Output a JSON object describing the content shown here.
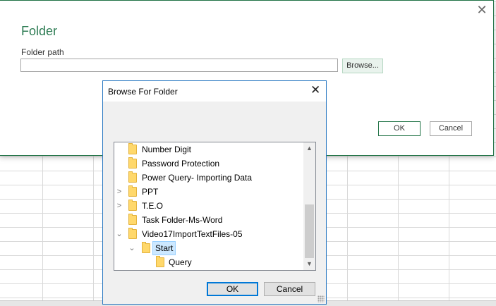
{
  "folder_dialog": {
    "title": "Folder",
    "path_label": "Folder path",
    "path_value": "",
    "browse_label": "Browse...",
    "ok_label": "OK",
    "cancel_label": "Cancel",
    "close_glyph": "✕"
  },
  "browse_dialog": {
    "title": "Browse For Folder",
    "close_glyph": "✕",
    "ok_label": "OK",
    "cancel_label": "Cancel",
    "tree": [
      {
        "label": "Number Digit",
        "expander": "",
        "depth": 0
      },
      {
        "label": "Password Protection",
        "expander": "",
        "depth": 0
      },
      {
        "label": "Power Query- Importing Data",
        "expander": "",
        "depth": 0
      },
      {
        "label": "PPT",
        "expander": "collapsed",
        "depth": 0
      },
      {
        "label": "T.E.O",
        "expander": "collapsed",
        "depth": 0
      },
      {
        "label": "Task Folder-Ms-Word",
        "expander": "",
        "depth": 0
      },
      {
        "label": "Video17ImportTextFiles-05",
        "expander": "expanded",
        "depth": 0
      },
      {
        "label": "Start",
        "expander": "expanded",
        "depth": 1,
        "selected": true
      },
      {
        "label": "Query",
        "expander": "",
        "depth": 2
      }
    ],
    "scroll_up_glyph": "▲",
    "scroll_down_glyph": "▼"
  },
  "colors": {
    "accent_green": "#217346",
    "title_green": "#2f7d55",
    "dialog_border_blue": "#2b79c2",
    "selection_blue": "#cce8ff",
    "folder_yellow": "#ffd86b"
  }
}
